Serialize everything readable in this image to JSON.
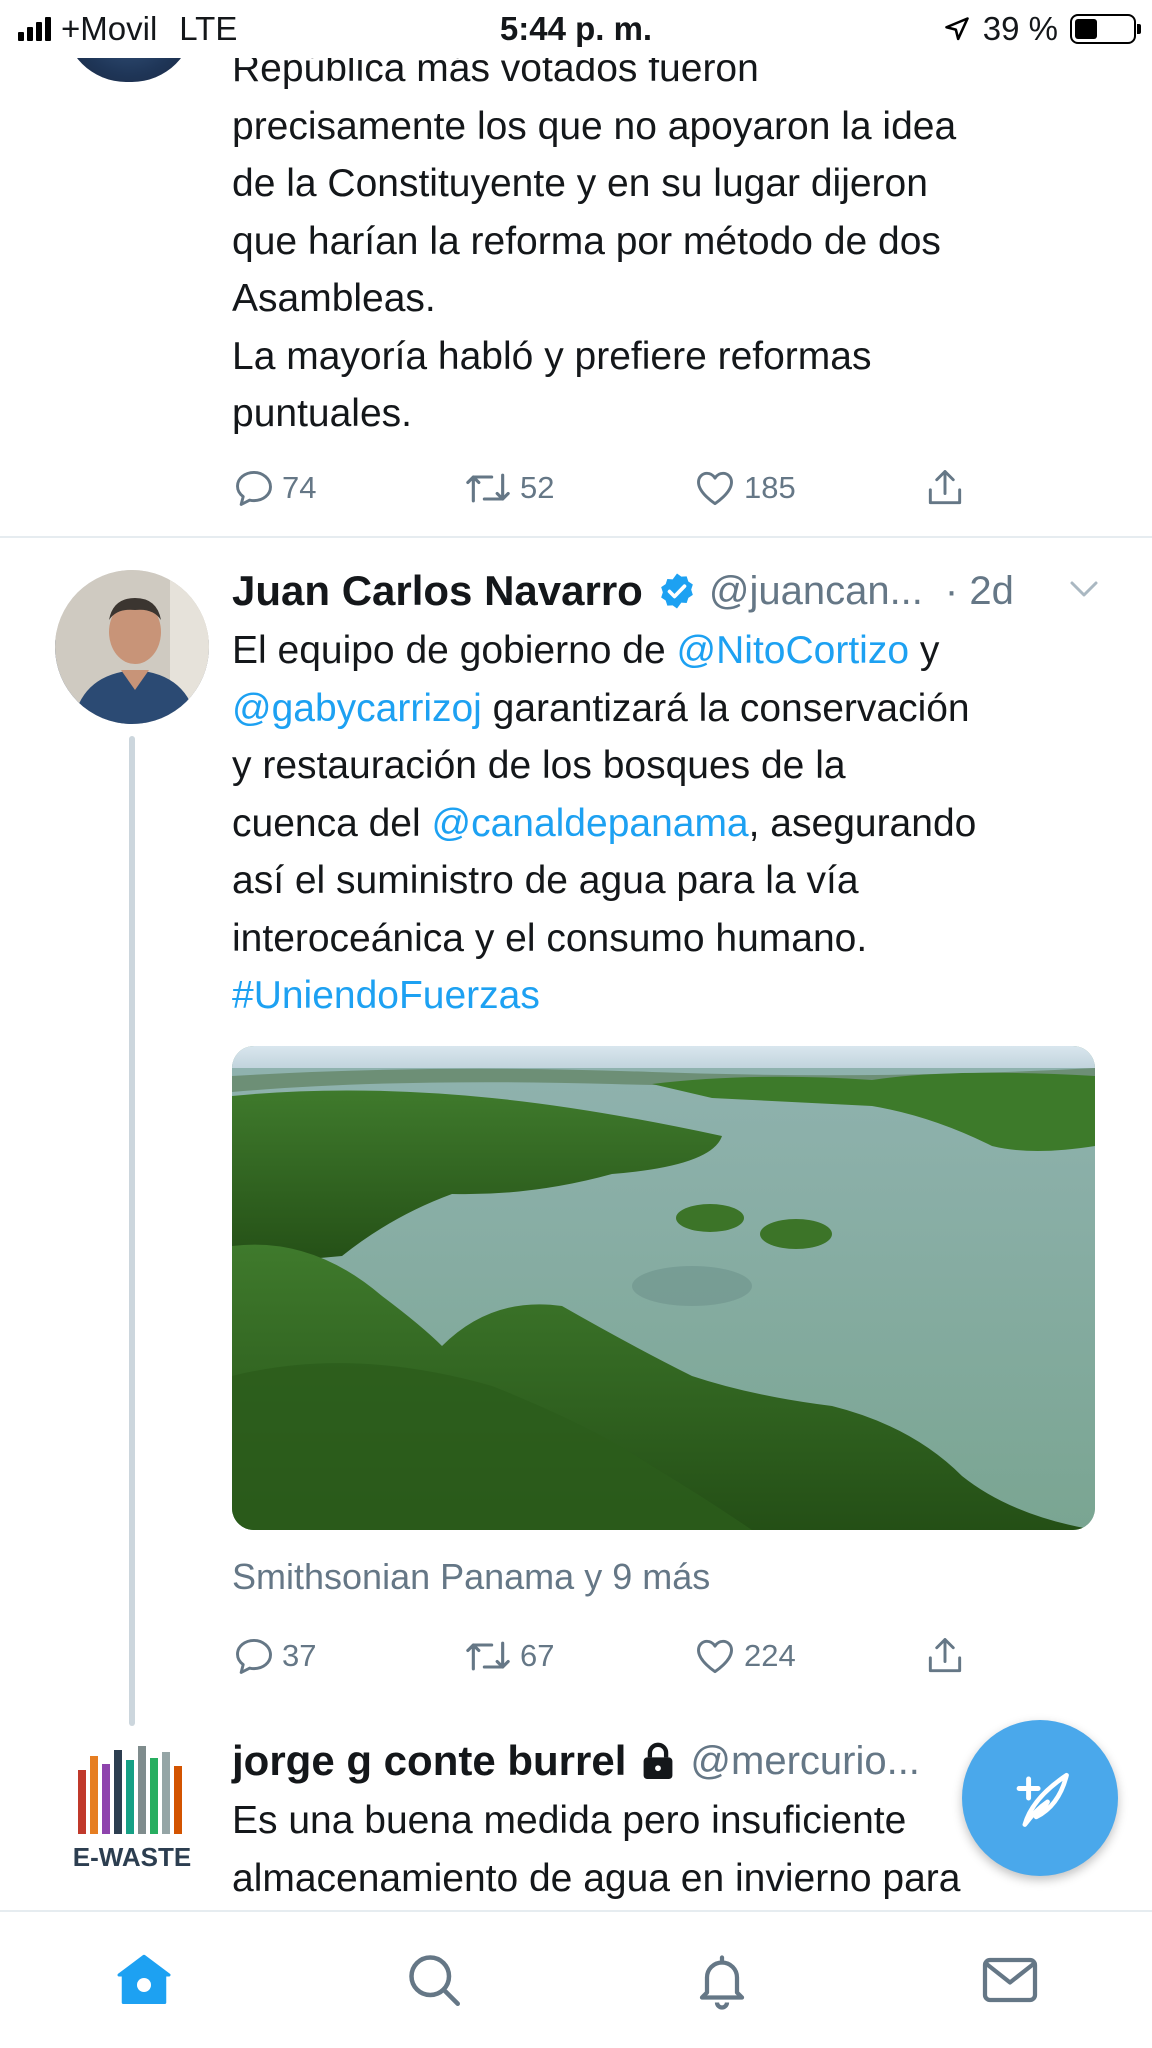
{
  "status_bar": {
    "carrier": "+Movil",
    "network": "LTE",
    "time": "5:44 p. m.",
    "battery": "39 %",
    "battery_level": 0.39
  },
  "tweets": [
    {
      "text_lines": [
        "República más votados fueron",
        "precisamente los que no apoyaron la idea",
        "de la Constituyente y en su lugar dijeron",
        "que harían la reforma por método de dos",
        "Asambleas.",
        "La mayoría habló y prefiere reformas",
        "puntuales."
      ],
      "replies": "74",
      "retweets": "52",
      "likes": "185"
    },
    {
      "name": "Juan Carlos Navarro",
      "handle": "@juancan...",
      "time": "· 2d",
      "text": {
        "l1_a": "El equipo de gobierno de ",
        "l1_link": "@NitoCortizo",
        "l1_b": " y",
        "l2_link": "@gabycarrizoj",
        "l2_b": " garantizará la conservación",
        "l3": "y restauración de los bosques de la",
        "l4_a": "cuenca del ",
        "l4_link": "@canaldepanama",
        "l4_b": ", asegurando",
        "l5": "así el suministro de agua para la vía",
        "l6": "interoceánica y el consumo humano.",
        "l7_link": "#UniendoFuerzas"
      },
      "tagged": "Smithsonian Panama y 9 más",
      "replies": "37",
      "retweets": "67",
      "likes": "224"
    },
    {
      "name": "jorge g conte burrel",
      "handle": "@mercurio...",
      "text_lines": [
        "Es una buena medida pero insuficiente",
        "almacenamiento de agua en invierno para"
      ],
      "avatar_text": "E-WASTE"
    }
  ],
  "colors": {
    "link": "#1da1f2",
    "secondary_text": "#657786",
    "fab": "#4aa8eb",
    "tab_active": "#1da1f2"
  },
  "tabs": [
    "home-icon",
    "search-icon",
    "notifications-icon",
    "messages-icon"
  ]
}
